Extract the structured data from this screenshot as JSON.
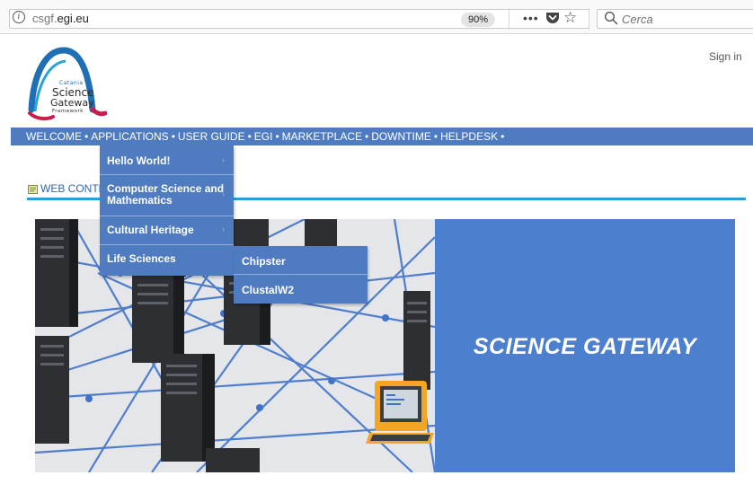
{
  "browser": {
    "url_host_prefix": "csgf.",
    "url_host_main": "egi.eu",
    "zoom": "90%",
    "search_placeholder": "Cerca"
  },
  "header": {
    "sign_in": "Sign in"
  },
  "logo": {
    "line1": "Catania",
    "line2": "Science",
    "line3": "Gateway",
    "line4": "Framework"
  },
  "nav": {
    "items": [
      "WELCOME",
      "APPLICATIONS",
      "USER GUIDE",
      "EGI",
      "MARKETPLACE",
      "DOWNTIME",
      "HELPDESK"
    ],
    "separator": "•"
  },
  "applications_menu": {
    "items": [
      {
        "label": "Hello World!"
      },
      {
        "label": "Computer Science and Mathematics"
      },
      {
        "label": "Cultural Heritage"
      },
      {
        "label": "Life Sciences"
      }
    ],
    "arrow": "›"
  },
  "life_sciences_submenu": {
    "items": [
      {
        "label": "Chipster"
      },
      {
        "label": "ClustalW2"
      }
    ]
  },
  "web_content": {
    "title": "WEB CONTENT"
  },
  "banner": {
    "title": "SCIENCE GATEWAY"
  },
  "colors": {
    "nav_blue": "#4f7bc1",
    "banner_blue": "#4d7fcf",
    "accent_rule": "#2a9fd6"
  }
}
